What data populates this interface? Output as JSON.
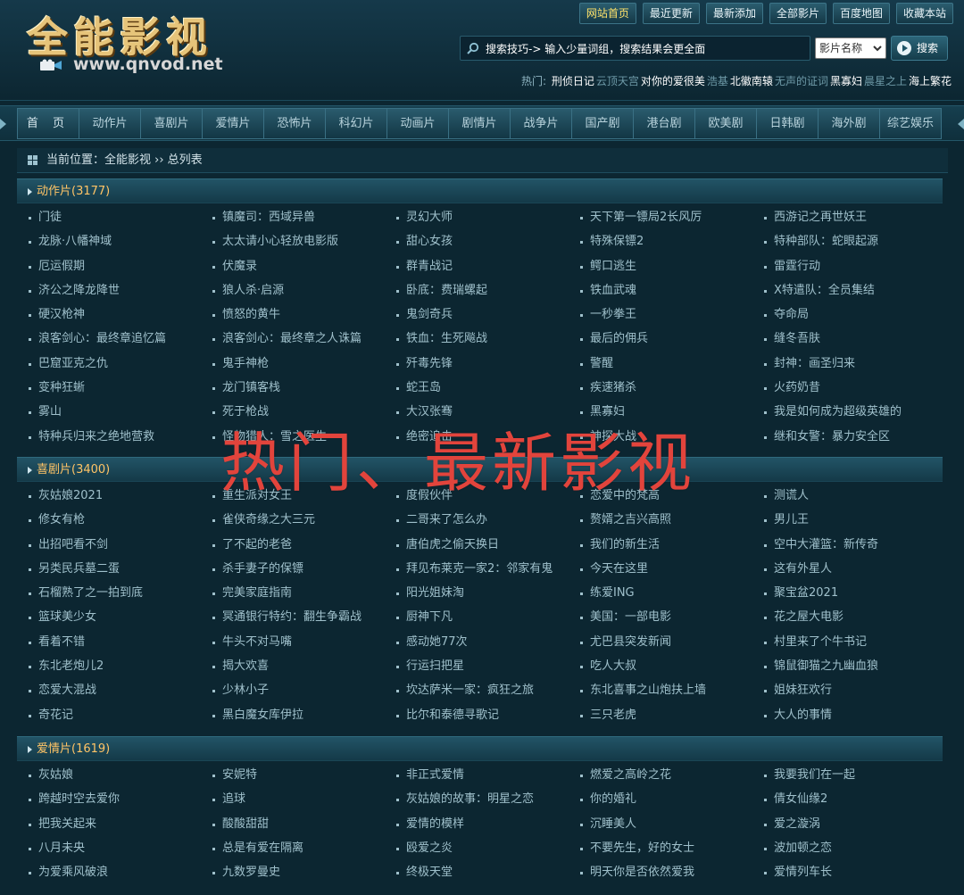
{
  "logo": {
    "title": "全能影视",
    "url": "www.qnvod.net"
  },
  "topnav": [
    "网站首页",
    "最近更新",
    "最新添加",
    "全部影片",
    "百度地图",
    "收藏本站"
  ],
  "search": {
    "placeholder": "搜索技巧-> 输入少量词组，搜索结果会更全面",
    "select_value": "影片名称",
    "button": "搜索"
  },
  "hot": {
    "label": "热门:",
    "items": [
      {
        "text": "刑侦日记",
        "tone": "w"
      },
      {
        "text": "云顶天宫",
        "tone": "g"
      },
      {
        "text": "对你的爱很美",
        "tone": "w"
      },
      {
        "text": "浩基",
        "tone": "g"
      },
      {
        "text": "北徽南辕",
        "tone": "w"
      },
      {
        "text": "无声的证词",
        "tone": "g"
      },
      {
        "text": "黑寡妇",
        "tone": "w"
      },
      {
        "text": "晨星之上",
        "tone": "g"
      },
      {
        "text": "海上繁花",
        "tone": "w"
      }
    ]
  },
  "menu": [
    "首 页",
    "动作片",
    "喜剧片",
    "爱情片",
    "恐怖片",
    "科幻片",
    "动画片",
    "剧情片",
    "战争片",
    "国产剧",
    "港台剧",
    "欧美剧",
    "日韩剧",
    "海外剧",
    "综艺娱乐"
  ],
  "breadcrumb": "当前位置：全能影视 ›› 总列表",
  "overlay_text": "热门、最新影视",
  "sections": [
    {
      "title": "动作片(3177)",
      "items": [
        "门徒",
        "镇魔司：西域异兽",
        "灵幻大师",
        "天下第一镖局2长风厉",
        "西游记之再世妖王",
        "龙脉·八幡神域",
        "太太请小心轻放电影版",
        "甜心女孩",
        "特殊保镖2",
        "特种部队：蛇眼起源",
        "厄运假期",
        "伏魔录",
        "群青战记",
        "鳄口逃生",
        "雷霆行动",
        "济公之降龙降世",
        "狼人杀·启源",
        "卧底：费瑞螺起",
        "铁血武魂",
        "X特遣队：全员集结",
        "硬汉枪神",
        "愤怒的黄牛",
        "鬼剑奇兵",
        "一秒拳王",
        "夺命局",
        "浪客剑心：最终章追忆篇",
        "浪客剑心：最终章之人诛篇",
        "铁血：生死飚战",
        "最后的佣兵",
        "缝冬吾肤",
        "巴窟亚克之仇",
        "鬼手神枪",
        "歼毒先锋",
        "警醒",
        "封神：画圣归来",
        "变种狂蜥",
        "龙门镇客栈",
        "蛇王岛",
        "疾速猪杀",
        "火药奶昔",
        "雾山",
        "死于枪战",
        "大汉张骞",
        "黑寡妇",
        "我是如何成为超级英雄的",
        "特种兵归来之绝地营救",
        "怪物猎人：雪之医生",
        "绝密追击",
        "神探大战",
        "继和女警：暴力安全区"
      ]
    },
    {
      "title": "喜剧片(3400)",
      "items": [
        "灰姑娘2021",
        "重生派对女王",
        "度假伙伴",
        "恋爱中的梵高",
        "测谎人",
        "修女有枪",
        "雀侠奇缘之大三元",
        "二哥来了怎么办",
        "赘婿之吉兴高照",
        "男儿王",
        "出招吧看不剑",
        "了不起的老爸",
        "唐伯虎之偷天换日",
        "我们的新生活",
        "空中大灌篮：新传奇",
        "另类民兵墓二蛋",
        "杀手妻子的保镖",
        "拜见布莱克一家2：邻家有鬼",
        "今天在这里",
        "这有外星人",
        "石榴熟了之一拍到底",
        "完美家庭指南",
        "阳光姐妹淘",
        "练爱ING",
        "聚宝盆2021",
        "篮球美少女",
        "冥通银行特约：翻生争霸战",
        "厨神下凡",
        "美国：一部电影",
        "花之屋大电影",
        "看着不错",
        "牛头不对马嘴",
        "感动她77次",
        "尤巴县突发新闻",
        "村里来了个牛书记",
        "东北老炮儿2",
        "揭大欢喜",
        "行运扫把星",
        "吃人大叔",
        "锦鼠御猫之九幽血狼",
        "恋爱大混战",
        "少林小子",
        "坎达萨米一家：疯狂之旅",
        "东北喜事之山炮扶上墙",
        "姐妹狂欢行",
        "奇花记",
        "黑白魔女库伊拉",
        "比尔和泰德寻歌记",
        "三只老虎",
        "大人的事情"
      ]
    },
    {
      "title": "爱情片(1619)",
      "items": [
        "灰姑娘",
        "安妮特",
        "非正式爱情",
        "燃爱之高岭之花",
        "我要我们在一起",
        "跨越时空去爱你",
        "追球",
        "灰姑娘的故事：明星之恋",
        "你的婚礼",
        "倩女仙缘2",
        "把我关起来",
        "酸酸甜甜",
        "爱情的模样",
        "沉睡美人",
        "爱之漩涡",
        "八月未央",
        "总是有爱在隔离",
        "殴爱之炎",
        "不要先生，好的女士",
        "波加顿之恋",
        "为爱乘风破浪",
        "九数罗曼史",
        "终极天堂",
        "明天你是否依然爱我",
        "爱情列车长"
      ]
    }
  ]
}
